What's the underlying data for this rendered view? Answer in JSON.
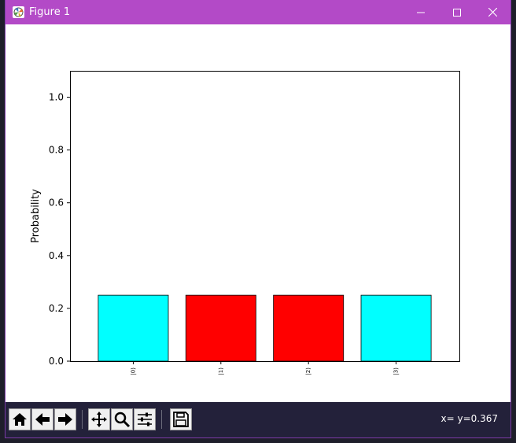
{
  "window": {
    "title": "Figure 1",
    "titlebar_color": "#b34ac7"
  },
  "chart_data": {
    "type": "bar",
    "categories": [
      "|0⟩",
      "|1⟩",
      "|2⟩",
      "|3⟩"
    ],
    "values": [
      0.25,
      0.25,
      0.25,
      0.25
    ],
    "colors": [
      "#00ffff",
      "#ff0000",
      "#ff0000",
      "#00ffff"
    ],
    "title": "",
    "xlabel": "",
    "ylabel": "Probability",
    "ylim": [
      0,
      1.1
    ],
    "yticks": [
      0.0,
      0.2,
      0.4,
      0.6,
      0.8,
      1.0
    ],
    "ytick_labels": [
      "0.0",
      "0.2",
      "0.4",
      "0.6",
      "0.8",
      "1.0"
    ],
    "grid": false,
    "xtick_rotation": "vertical"
  },
  "toolbar": {
    "home_icon": "home-icon",
    "back_icon": "back-arrow-icon",
    "forward_icon": "forward-arrow-icon",
    "pan_icon": "move-icon",
    "zoom_icon": "magnifier-icon",
    "configure_icon": "sliders-icon",
    "save_icon": "floppy-icon",
    "coords_text": "x= y=0.367"
  }
}
